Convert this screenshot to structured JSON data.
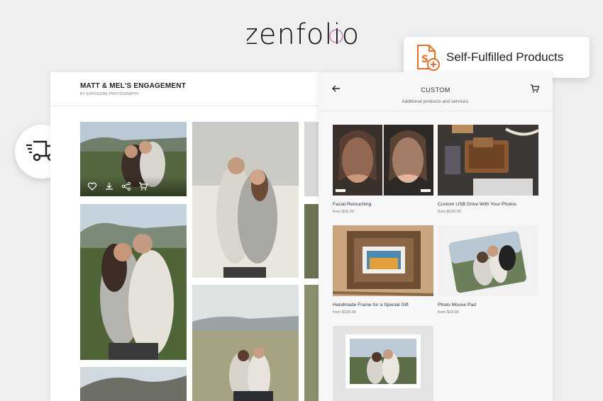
{
  "brand": {
    "logo_text": "zenfolio"
  },
  "badge": {
    "label": "Self-Fulfilled Products",
    "icon": "document-plus-icon",
    "accent": "#e2712b"
  },
  "shipping": {
    "icon": "delivery-truck-icon"
  },
  "gallery": {
    "title": "MATT & MEL'S ENGAGEMENT",
    "subtitle": "BY EXPOSURE PHOTOGRAPHY",
    "photo_actions": [
      "heart-icon",
      "download-icon",
      "share-icon",
      "cart-icon"
    ]
  },
  "custom": {
    "title": "CUSTOM",
    "subtitle": "Additional products and services.",
    "back_icon": "back-arrow-icon",
    "cart_icon": "cart-icon",
    "products": [
      {
        "name": "Facial Retouching",
        "price": "from $18.00"
      },
      {
        "name": "Custom USB Drive With Your Photos",
        "price": "from $136.00"
      },
      {
        "name": "Handmade Frame for a Special Gift",
        "price": "from $120.00"
      },
      {
        "name": "Photo Mouse Pad",
        "price": "from $24.00"
      }
    ]
  },
  "colors": {
    "background": "#efefef",
    "panel": "#ffffff",
    "logo_accent": "#b0369b"
  }
}
